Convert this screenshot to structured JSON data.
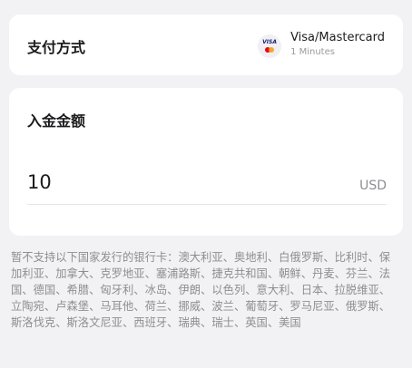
{
  "payment": {
    "label": "支付方式",
    "method_name": "Visa/Mastercard",
    "method_time": "1 Minutes",
    "logo_text": "VISA",
    "logo_icon": "visa-mastercard-icon"
  },
  "amount": {
    "title": "入金金额",
    "value": "10",
    "currency": "USD"
  },
  "notice": "暂不支持以下国家发行的银行卡：澳大利亚、奥地利、白俄罗斯、比利时、保加利亚、加拿大、克罗地亚、塞浦路斯、捷克共和国、朝鲜、丹麦、芬兰、法国、德国、希腊、匈牙利、冰岛、伊朗、以色列、意大利、日本、拉脱维亚、立陶宛、卢森堡、马耳他、荷兰、挪威、波兰、葡萄牙、罗马尼亚、俄罗斯、斯洛伐克、斯洛文尼亚、西班牙、瑞典、瑞士、英国、美国",
  "colors": {
    "background": "#f2f2f4",
    "card": "#ffffff",
    "text_primary": "#1c1c1e",
    "text_secondary": "#8e8e93",
    "visa_blue": "#1a1f71",
    "mc_red": "#eb001b",
    "mc_orange": "#f79e1b"
  }
}
